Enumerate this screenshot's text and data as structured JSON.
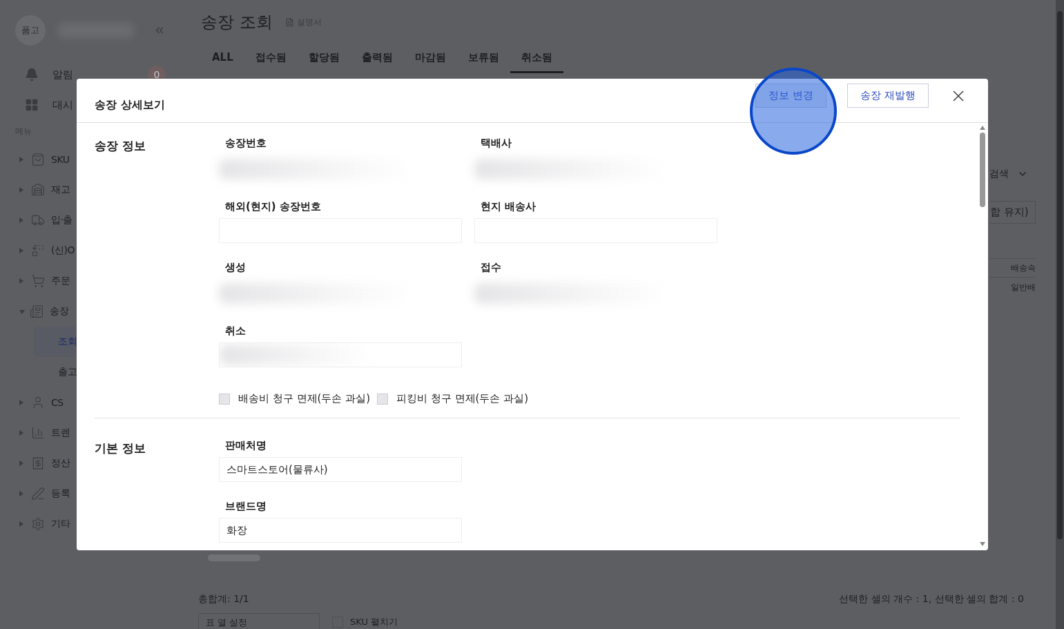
{
  "sidebar": {
    "logo": "품고",
    "alerts": {
      "label": "알림",
      "count": "0"
    },
    "dashboard": "대시",
    "section_label": "메뉴",
    "items": [
      {
        "label": "SKU",
        "expanded": false
      },
      {
        "label": "재고",
        "expanded": false
      },
      {
        "label": "입·출",
        "expanded": false
      },
      {
        "label": "(신)O",
        "expanded": false
      },
      {
        "label": "주문",
        "expanded": false
      },
      {
        "label": "송장",
        "expanded": true,
        "children": [
          {
            "label": "조회",
            "selected": true
          },
          {
            "label": "출고",
            "selected": false
          }
        ]
      },
      {
        "label": "CS",
        "expanded": false
      },
      {
        "label": "트렌",
        "expanded": false
      },
      {
        "label": "정산",
        "expanded": false
      },
      {
        "label": "등록",
        "expanded": false
      },
      {
        "label": "기타",
        "expanded": false
      }
    ]
  },
  "page": {
    "title": "송장 조회",
    "manual_link": "설명서",
    "tabs": [
      {
        "label": "ALL",
        "selected": false
      },
      {
        "label": "접수됨",
        "selected": false
      },
      {
        "label": "할당됨",
        "selected": false
      },
      {
        "label": "출력됨",
        "selected": false
      },
      {
        "label": "마감됨",
        "selected": false
      },
      {
        "label": "보류됨",
        "selected": false
      },
      {
        "label": "취소됨",
        "selected": true
      }
    ],
    "search_toggle": "검색",
    "keep_button": "합 유지)",
    "table_columns": [
      "배송속"
    ],
    "table_cells": [
      "일반배"
    ],
    "total": "총합계: 1/1",
    "selection_summary": "선택한 셀의 개수 : 1, 선택한 셀의 합계 : 0",
    "column_settings": "표 열 설정",
    "sku_expand": {
      "label": "SKU 펼치기",
      "checked": false
    }
  },
  "modal": {
    "title": "송장 상세보기",
    "buttons": [
      "정보 변경",
      "송장 재발행"
    ],
    "sections": [
      {
        "title": "송장 정보",
        "kind": "grid",
        "fields": [
          {
            "label": "송장번호",
            "kind": "blurred"
          },
          {
            "label": "택배사",
            "kind": "blurred"
          },
          {
            "label": "해외(현지) 송장번호",
            "kind": "input"
          },
          {
            "label": "현지 배송사",
            "kind": "input"
          },
          {
            "label": "생성",
            "kind": "blurred"
          },
          {
            "label": "접수",
            "kind": "blurred"
          },
          {
            "label": "취소",
            "kind": "blurred_input"
          }
        ],
        "checkboxes": [
          {
            "label": "배송비 청구 면제(두손 과실)",
            "checked": false
          },
          {
            "label": "피킹비 청구 면제(두손 과실)",
            "checked": false
          }
        ]
      },
      {
        "title": "기본 정보",
        "kind": "stack",
        "fields": [
          {
            "label": "판매처명",
            "kind": "input",
            "value": "스마트스토어(물류사)"
          },
          {
            "label": "브랜드명",
            "kind": "input",
            "value": "화장"
          }
        ]
      }
    ]
  }
}
